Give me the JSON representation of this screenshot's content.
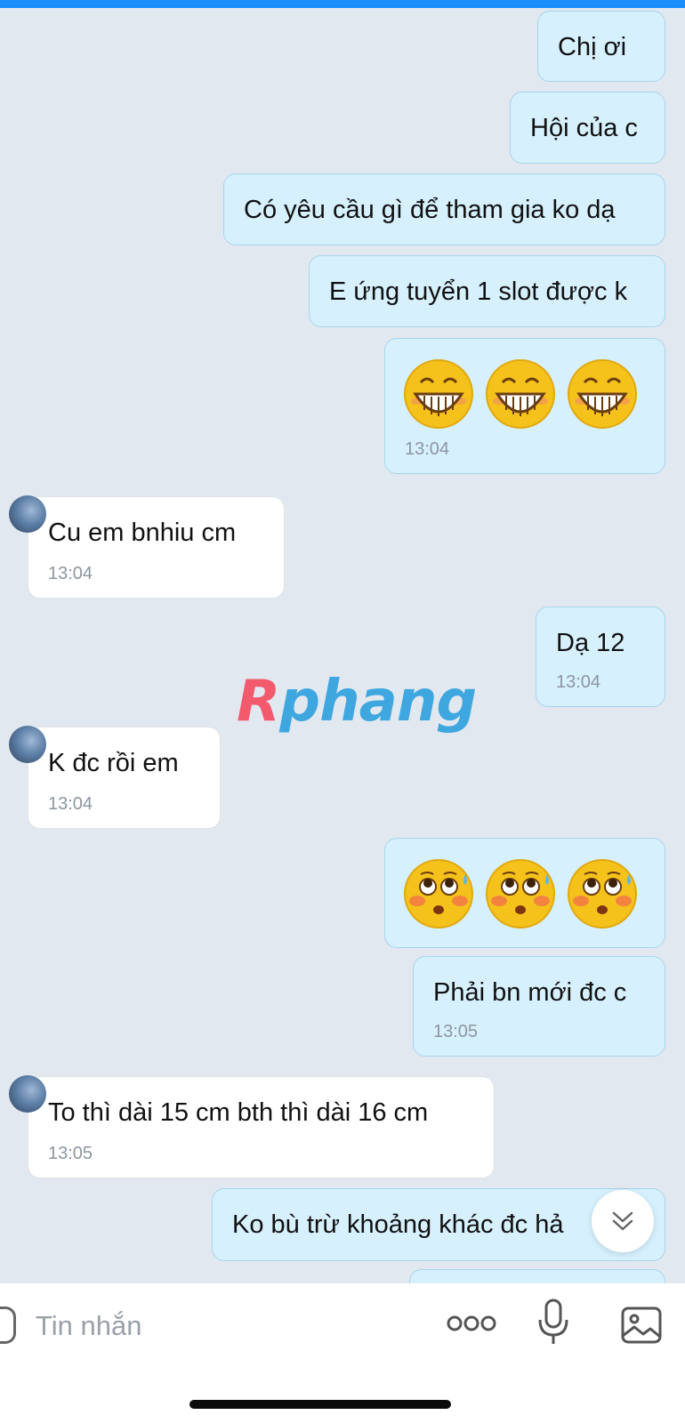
{
  "colors": {
    "accent": "#1b8dfa",
    "outgoing_bubble": "#d6f0fd",
    "incoming_bubble": "#ffffff",
    "background": "#e2e8f0"
  },
  "messages": [
    {
      "side": "me",
      "text": "Chị ơi"
    },
    {
      "side": "me",
      "text": "Hội của c"
    },
    {
      "side": "me",
      "text": "Có yêu cầu gì để tham gia ko dạ"
    },
    {
      "side": "me",
      "text": "E ứng tuyển 1 slot được k"
    },
    {
      "side": "me",
      "emoji": "grinning-face-emoji",
      "emoji_count": 3,
      "time": "13:04"
    },
    {
      "side": "them",
      "text": "Cu em bnhiu cm",
      "time": "13:04"
    },
    {
      "side": "me",
      "text": "Dạ 12",
      "time": "13:04"
    },
    {
      "side": "them",
      "text": "K đc rồi em",
      "time": "13:04"
    },
    {
      "side": "me",
      "emoji": "flushed-sweat-face-emoji",
      "emoji_count": 3
    },
    {
      "side": "me",
      "text": "Phải bn mới đc c",
      "time": "13:05"
    },
    {
      "side": "them",
      "text": "To thì dài 15 cm bth thì dài 16 cm",
      "time": "13:05"
    },
    {
      "side": "me",
      "text": "Ko bù trừ khoảng khác đc hả"
    }
  ],
  "watermark": {
    "first_letter": "R",
    "rest": "phang"
  },
  "composer": {
    "placeholder": "Tin nhắn",
    "icons": [
      "sticker-icon",
      "more-icon",
      "microphone-icon",
      "image-icon"
    ]
  },
  "scroll_down_icon": "double-chevron-down-icon"
}
